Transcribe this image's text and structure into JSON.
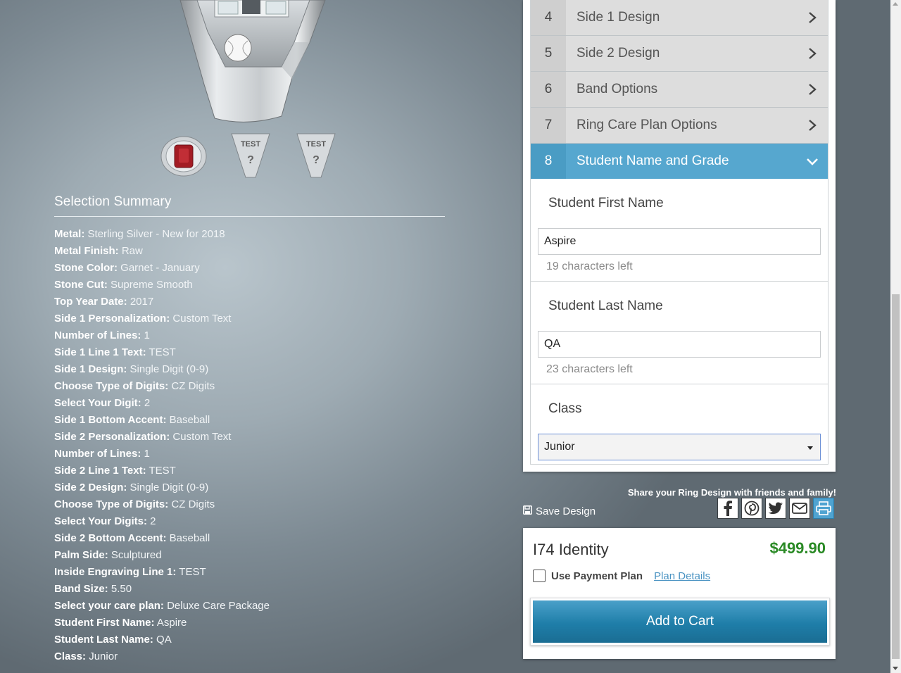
{
  "steps": [
    {
      "num": "4",
      "label": "Side 1 Design"
    },
    {
      "num": "5",
      "label": "Side 2 Design"
    },
    {
      "num": "6",
      "label": "Band Options"
    },
    {
      "num": "7",
      "label": "Ring Care Plan Options"
    },
    {
      "num": "8",
      "label": "Student Name and Grade"
    }
  ],
  "form": {
    "first_name": {
      "title": "Student First Name",
      "value": "Aspire",
      "hint": "19 characters left"
    },
    "last_name": {
      "title": "Student Last Name",
      "value": "QA",
      "hint": "23 characters left"
    },
    "class": {
      "title": "Class",
      "selected": "Junior"
    }
  },
  "summary": {
    "title": "Selection Summary",
    "items": [
      {
        "label": "Metal:",
        "value": "Sterling Silver - New for 2018"
      },
      {
        "label": "Metal Finish:",
        "value": "Raw"
      },
      {
        "label": "Stone Color:",
        "value": "Garnet - January"
      },
      {
        "label": "Stone Cut:",
        "value": "Supreme Smooth"
      },
      {
        "label": "Top Year Date:",
        "value": "2017"
      },
      {
        "label": "Side 1 Personalization:",
        "value": "Custom Text"
      },
      {
        "label": "Number of Lines:",
        "value": "1"
      },
      {
        "label": "Side 1 Line 1 Text:",
        "value": "TEST"
      },
      {
        "label": "Side 1 Design:",
        "value": "Single Digit (0-9)"
      },
      {
        "label": "Choose Type of Digits:",
        "value": "CZ Digits"
      },
      {
        "label": "Select Your Digit:",
        "value": "2"
      },
      {
        "label": "Side 1 Bottom Accent:",
        "value": "Baseball"
      },
      {
        "label": "Side 2 Personalization:",
        "value": "Custom Text"
      },
      {
        "label": "Number of Lines:",
        "value": "1"
      },
      {
        "label": "Side 2 Line 1 Text:",
        "value": "TEST"
      },
      {
        "label": "Side 2 Design:",
        "value": "Single Digit (0-9)"
      },
      {
        "label": "Choose Type of Digits:",
        "value": "CZ Digits"
      },
      {
        "label": "Select Your Digits:",
        "value": "2"
      },
      {
        "label": "Side 2 Bottom Accent:",
        "value": "Baseball"
      },
      {
        "label": "Palm Side:",
        "value": "Sculptured"
      },
      {
        "label": "Inside Engraving Line 1:",
        "value": "TEST"
      },
      {
        "label": "Band Size:",
        "value": "5.50"
      },
      {
        "label": "Select your care plan:",
        "value": "Deluxe Care Package"
      },
      {
        "label": "Student First Name:",
        "value": "Aspire"
      },
      {
        "label": "Student Last Name:",
        "value": "QA"
      },
      {
        "label": "Class:",
        "value": "Junior"
      }
    ]
  },
  "share": {
    "text": "Share your Ring Design with friends and family!"
  },
  "save_design": {
    "label": "Save Design"
  },
  "product": {
    "name": "I74 Identity",
    "price": "$499.90",
    "payment_plan_label": "Use Payment Plan",
    "plan_details_link": "Plan Details",
    "add_to_cart_label": "Add to Cart"
  },
  "thumb_text": "TEST",
  "colors": {
    "accent": "#56a7cf",
    "price": "#2a8a25",
    "button": "#1f7ea9",
    "stone": "#a31c24"
  }
}
